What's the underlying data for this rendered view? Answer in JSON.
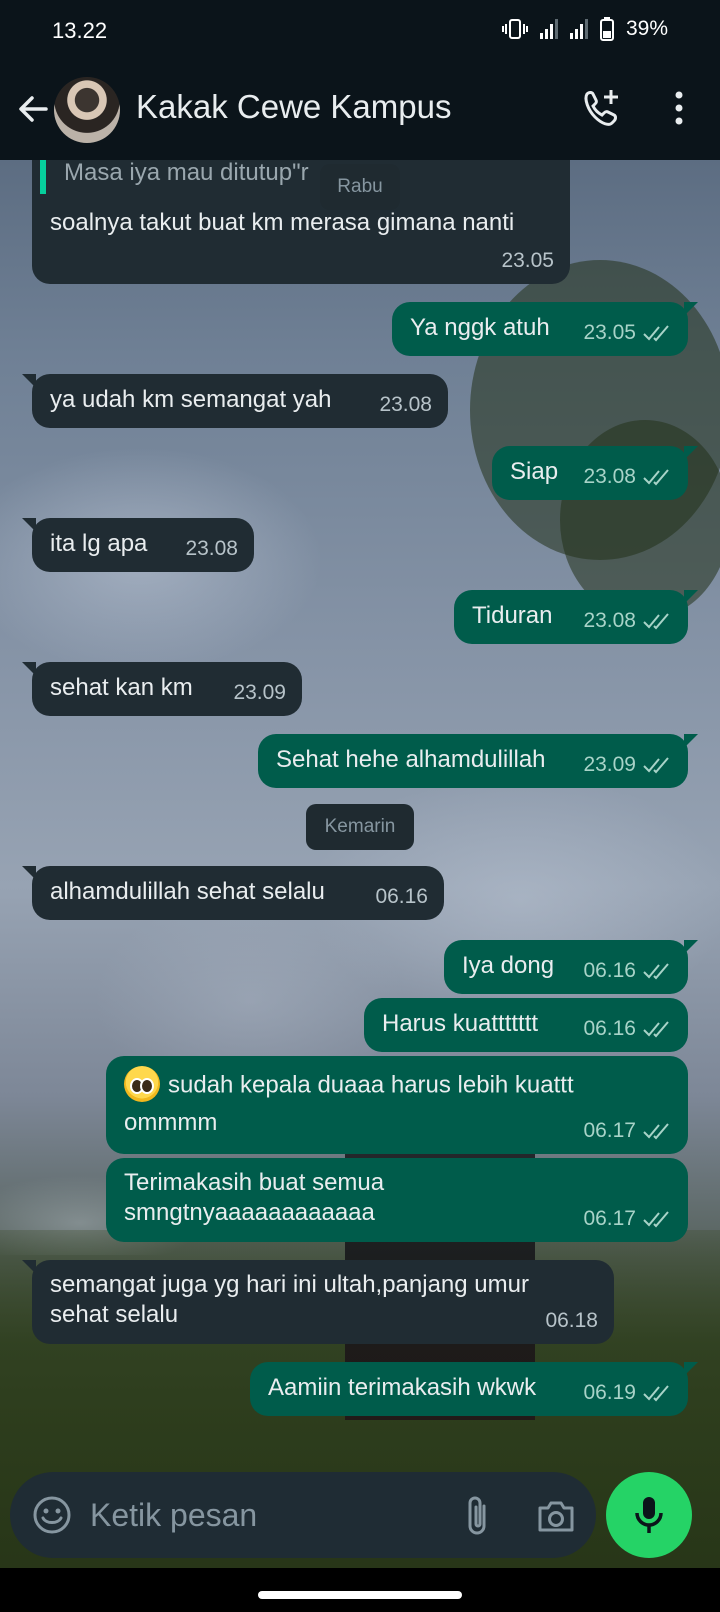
{
  "status_bar": {
    "time": "13.22",
    "battery": "39%"
  },
  "header": {
    "contact_name": "Kakak Cewe Kampus"
  },
  "date_chips": {
    "rabu": "Rabu",
    "kemarin": "Kemarin"
  },
  "messages": [
    {
      "dir": "in",
      "quoted": "Masa iya mau ditutup\"r",
      "text": "soalnya takut buat km merasa gimana nanti",
      "time": "23.05"
    },
    {
      "dir": "out",
      "text": "Ya nggk atuh",
      "time": "23.05"
    },
    {
      "dir": "in",
      "text": "ya udah km semangat yah",
      "time": "23.08"
    },
    {
      "dir": "out",
      "text": "Siap",
      "time": "23.08"
    },
    {
      "dir": "in",
      "text": "ita lg apa",
      "time": "23.08"
    },
    {
      "dir": "out",
      "text": "Tiduran",
      "time": "23.08"
    },
    {
      "dir": "in",
      "text": "sehat kan km",
      "time": "23.09"
    },
    {
      "dir": "out",
      "text": "Sehat hehe alhamdulillah",
      "time": "23.09"
    },
    {
      "dir": "in",
      "text": "alhamdulillah sehat selalu",
      "time": "06.16"
    },
    {
      "dir": "out",
      "text": "Iya dong",
      "time": "06.16"
    },
    {
      "dir": "out",
      "text": "Harus kuattttttt",
      "time": "06.16"
    },
    {
      "dir": "out",
      "emoji": "pleading-face",
      "text_line1": "sudah kepala duaaa harus lebih kuattt",
      "text_line2": "ommmm",
      "time": "06.17"
    },
    {
      "dir": "out",
      "text_line1": "Terimakasih buat semua",
      "text_line2": "smngtnyaaaaaaaaaaaa",
      "time": "06.17"
    },
    {
      "dir": "in",
      "text_line1": "semangat juga yg hari ini ultah,panjang umur",
      "text_line2": "sehat selalu",
      "time": "06.18"
    },
    {
      "dir": "out",
      "text": "Aamiin terimakasih wkwk",
      "time": "06.19"
    }
  ],
  "composer": {
    "placeholder": "Ketik pesan"
  },
  "colors": {
    "incoming_bubble": "#202c33",
    "outgoing_bubble": "#005c4b",
    "accent_green": "#25d366",
    "header_bg": "#0b141a",
    "read_ticks": "#a8d3c8"
  },
  "icons": {
    "header": [
      "back-arrow-icon",
      "add-call-icon",
      "more-vert-icon"
    ],
    "composer": [
      "emoji-icon",
      "attach-icon",
      "camera-icon",
      "mic-icon"
    ],
    "message_status": "double-check-icon"
  }
}
